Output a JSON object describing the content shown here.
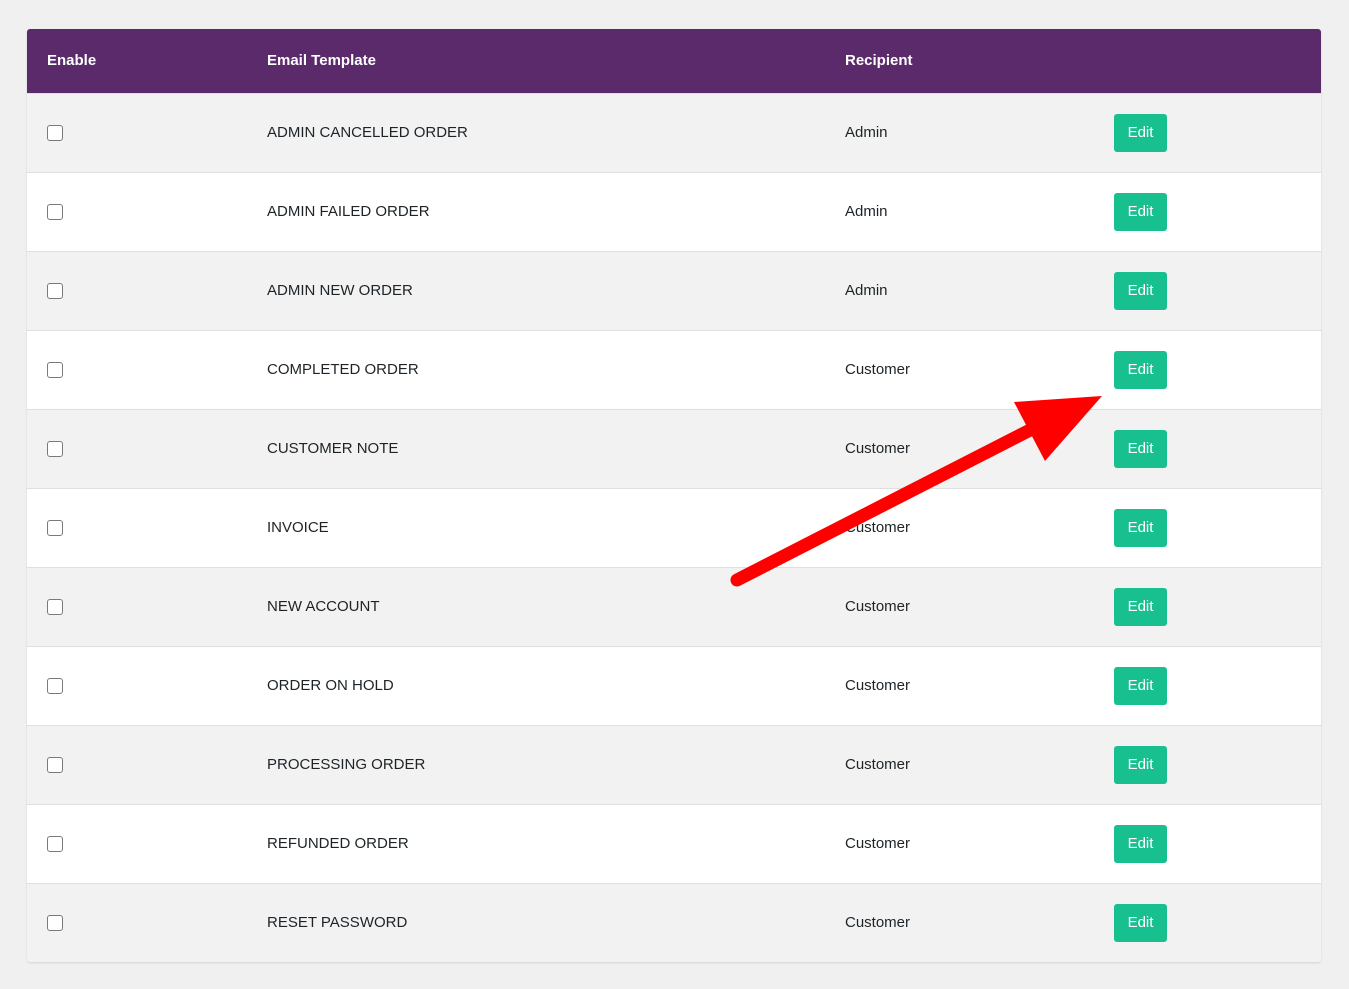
{
  "table": {
    "headers": {
      "enable": "Enable",
      "template": "Email Template",
      "recipient": "Recipient",
      "action": ""
    },
    "rows": [
      {
        "template": "ADMIN CANCELLED ORDER",
        "recipient": "Admin",
        "action": "Edit",
        "enabled": false
      },
      {
        "template": "ADMIN FAILED ORDER",
        "recipient": "Admin",
        "action": "Edit",
        "enabled": false
      },
      {
        "template": "ADMIN NEW ORDER",
        "recipient": "Admin",
        "action": "Edit",
        "enabled": false
      },
      {
        "template": "COMPLETED ORDER",
        "recipient": "Customer",
        "action": "Edit",
        "enabled": false
      },
      {
        "template": "CUSTOMER NOTE",
        "recipient": "Customer",
        "action": "Edit",
        "enabled": false
      },
      {
        "template": "INVOICE",
        "recipient": "Customer",
        "action": "Edit",
        "enabled": false
      },
      {
        "template": "NEW ACCOUNT",
        "recipient": "Customer",
        "action": "Edit",
        "enabled": false
      },
      {
        "template": "ORDER ON HOLD",
        "recipient": "Customer",
        "action": "Edit",
        "enabled": false
      },
      {
        "template": "PROCESSING ORDER",
        "recipient": "Customer",
        "action": "Edit",
        "enabled": false
      },
      {
        "template": "REFUNDED ORDER",
        "recipient": "Customer",
        "action": "Edit",
        "enabled": false
      },
      {
        "template": "RESET PASSWORD",
        "recipient": "Customer",
        "action": "Edit",
        "enabled": false
      }
    ]
  },
  "colors": {
    "header_bg": "#5b2a6b",
    "edit_button": "#19c08f",
    "annotation_arrow": "#ff0000"
  },
  "annotation": {
    "icon": "red-arrow-icon"
  }
}
